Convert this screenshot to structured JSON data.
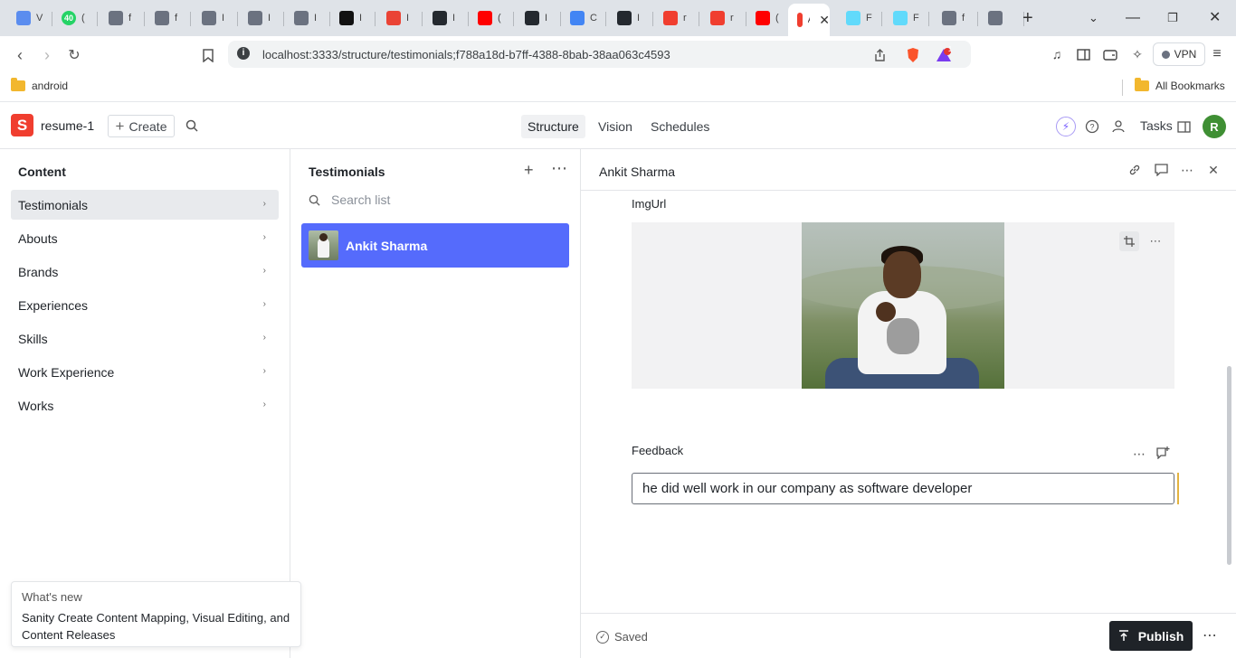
{
  "browser": {
    "tabs": [
      {
        "favicon": "snowflake-icon",
        "title": "V",
        "color": "#5b8def"
      },
      {
        "favicon": "whatsapp-icon",
        "title": "(",
        "color": "#25d366",
        "badge": "40"
      },
      {
        "favicon": "nxt-icon",
        "title": "f",
        "color": "#6b7280"
      },
      {
        "favicon": "globe-icon",
        "title": "f",
        "color": "#6b7280"
      },
      {
        "favicon": "nxt-icon",
        "title": "I",
        "color": "#6b7280"
      },
      {
        "favicon": "nxt-icon",
        "title": "I",
        "color": "#6b7280"
      },
      {
        "favicon": "nxt-icon",
        "title": "I",
        "color": "#6b7280"
      },
      {
        "favicon": "hackerrank-icon",
        "title": "I",
        "color": "#111111"
      },
      {
        "favicon": "gmail-icon",
        "title": "I",
        "color": "#ea4335"
      },
      {
        "favicon": "github-icon",
        "title": "I",
        "color": "#24292f"
      },
      {
        "favicon": "youtube-icon",
        "title": "(",
        "color": "#ff0000"
      },
      {
        "favicon": "github-icon",
        "title": "I",
        "color": "#24292f"
      },
      {
        "favicon": "google-icon",
        "title": "C",
        "color": "#4285f4"
      },
      {
        "favicon": "github-icon",
        "title": "I",
        "color": "#24292f"
      },
      {
        "favicon": "sanity-icon",
        "title": "r",
        "color": "#f03e2f"
      },
      {
        "favicon": "sanity-icon",
        "title": "r",
        "color": "#f03e2f"
      },
      {
        "favicon": "youtube-icon",
        "title": "(",
        "color": "#ff0000"
      },
      {
        "favicon": "sanity-icon",
        "title": "A",
        "color": "#ffffff",
        "active": true
      },
      {
        "favicon": "react-icon",
        "title": "F",
        "color": "#61dafb"
      },
      {
        "favicon": "react-icon",
        "title": "F",
        "color": "#61dafb"
      },
      {
        "favicon": "globe-icon",
        "title": "f",
        "color": "#6b7280"
      },
      {
        "favicon": "globe-icon",
        "title": "",
        "color": "#6b7280"
      }
    ],
    "url": "localhost:3333/structure/testimonials;f788a18d-b7ff-4388-8bab-38aa063c4593",
    "notif_count": "1",
    "vpn_label": "VPN",
    "bookmarks": {
      "left": "android",
      "right": "All Bookmarks"
    }
  },
  "studio": {
    "project": "resume-1",
    "create_label": "Create",
    "nav": [
      "Structure",
      "Vision",
      "Schedules"
    ],
    "tasks_label": "Tasks",
    "avatar_initial": "R"
  },
  "content_pane": {
    "title": "Content",
    "items": [
      "Testimonials",
      "Abouts",
      "Brands",
      "Experiences",
      "Skills",
      "Work Experience",
      "Works"
    ]
  },
  "list_pane": {
    "title": "Testimonials",
    "search_placeholder": "Search list",
    "documents": [
      {
        "name": "Ankit Sharma"
      }
    ]
  },
  "document": {
    "title": "Ankit Sharma",
    "img_label": "ImgUrl",
    "feedback_label": "Feedback",
    "feedback_value": "he did well work in our company as software developer",
    "status": "Saved",
    "publish_label": "Publish"
  },
  "whats_new": {
    "heading": "What's new",
    "text": "Sanity Create Content Mapping, Visual Editing, and Content Releases"
  }
}
